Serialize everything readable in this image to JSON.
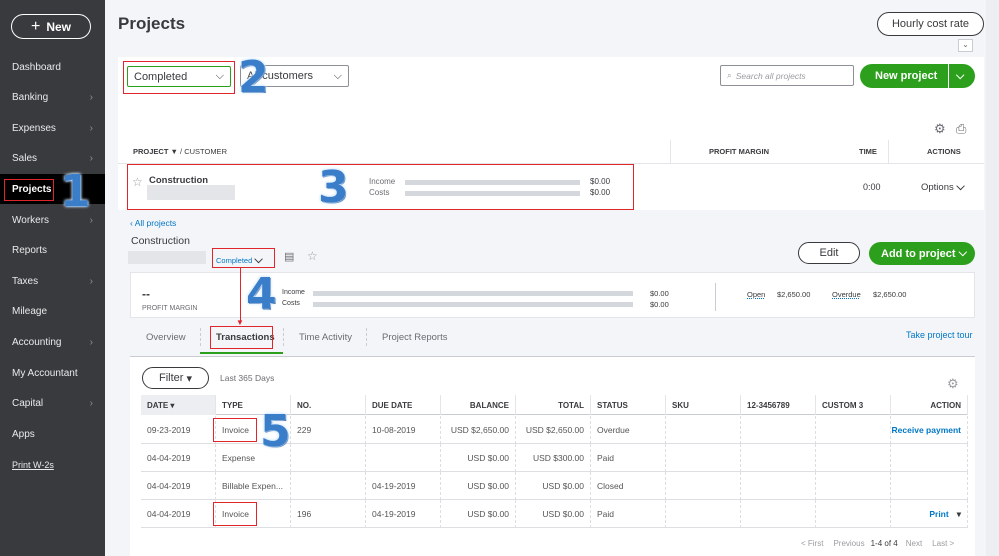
{
  "sidebar": {
    "new_label": "New",
    "items": [
      {
        "label": "Dashboard",
        "chevron": false
      },
      {
        "label": "Banking",
        "chevron": true
      },
      {
        "label": "Expenses",
        "chevron": true
      },
      {
        "label": "Sales",
        "chevron": true
      },
      {
        "label": "Projects",
        "chevron": false,
        "active": true
      },
      {
        "label": "Workers",
        "chevron": true
      },
      {
        "label": "Reports",
        "chevron": false
      },
      {
        "label": "Taxes",
        "chevron": true
      },
      {
        "label": "Mileage",
        "chevron": false
      },
      {
        "label": "Accounting",
        "chevron": true
      },
      {
        "label": "My Accountant",
        "chevron": false
      },
      {
        "label": "Capital",
        "chevron": true
      },
      {
        "label": "Apps",
        "chevron": false
      }
    ],
    "link": "Print W-2s"
  },
  "header": {
    "title": "Projects",
    "hourly_cost_rate": "Hourly cost rate"
  },
  "filters": {
    "status": "Completed",
    "customer": "All customers",
    "search_placeholder": "Search all projects",
    "new_project": "New project"
  },
  "projects_table": {
    "col_project": "PROJECT",
    "col_customer": "/ CUSTOMER",
    "col_profit": "PROFIT MARGIN",
    "col_time": "TIME",
    "col_actions": "ACTIONS",
    "row": {
      "name": "Construction",
      "income_label": "Income",
      "costs_label": "Costs",
      "income": "$0.00",
      "costs": "$0.00",
      "time": "0:00",
      "action": "Options"
    }
  },
  "detail": {
    "back": "All projects",
    "name": "Construction",
    "status": "Completed",
    "edit": "Edit",
    "add": "Add to project",
    "summary": {
      "margin": "--",
      "margin_label": "PROFIT MARGIN",
      "income_label": "Income",
      "costs_label": "Costs",
      "income": "$0.00",
      "costs": "$0.00",
      "open_label": "Open",
      "open": "$2,650.00",
      "overdue_label": "Overdue",
      "overdue": "$2,650.00"
    },
    "tabs": [
      "Overview",
      "Transactions",
      "Time Activity",
      "Project Reports"
    ],
    "active_tab": "Transactions",
    "tour": "Take project tour"
  },
  "transactions": {
    "filter": "Filter",
    "range": "Last 365 Days",
    "columns": [
      "DATE",
      "TYPE",
      "NO.",
      "DUE DATE",
      "BALANCE",
      "TOTAL",
      "STATUS",
      "SKU",
      "12-3456789",
      "CUSTOM 3",
      "ACTION"
    ],
    "rows": [
      [
        "09-23-2019",
        "Invoice",
        "229",
        "10-08-2019",
        "USD $2,650.00",
        "USD $2,650.00",
        "Overdue",
        "",
        "",
        "",
        "Receive payment"
      ],
      [
        "04-04-2019",
        "Expense",
        "",
        "",
        "USD $0.00",
        "USD $300.00",
        "Paid",
        "",
        "",
        "",
        ""
      ],
      [
        "04-04-2019",
        "Billable Expen...",
        "",
        "04-19-2019",
        "USD $0.00",
        "USD $0.00",
        "Closed",
        "",
        "",
        "",
        ""
      ],
      [
        "04-04-2019",
        "Invoice",
        "196",
        "04-19-2019",
        "USD $0.00",
        "USD $0.00",
        "Paid",
        "",
        "",
        "",
        "Print"
      ]
    ],
    "pagination": {
      "first": "< First",
      "previous": "Previous",
      "range": "1-4 of 4",
      "next": "Next",
      "last": "Last >"
    }
  },
  "annotations": [
    "1",
    "2",
    "3",
    "4",
    "5"
  ],
  "colors": {
    "sidebar": "#393a3d",
    "accent_green": "#2ca01c",
    "link_blue": "#0077c5",
    "annotation_red": "#e0262b",
    "annotation_blue": "#3a7dc9"
  }
}
